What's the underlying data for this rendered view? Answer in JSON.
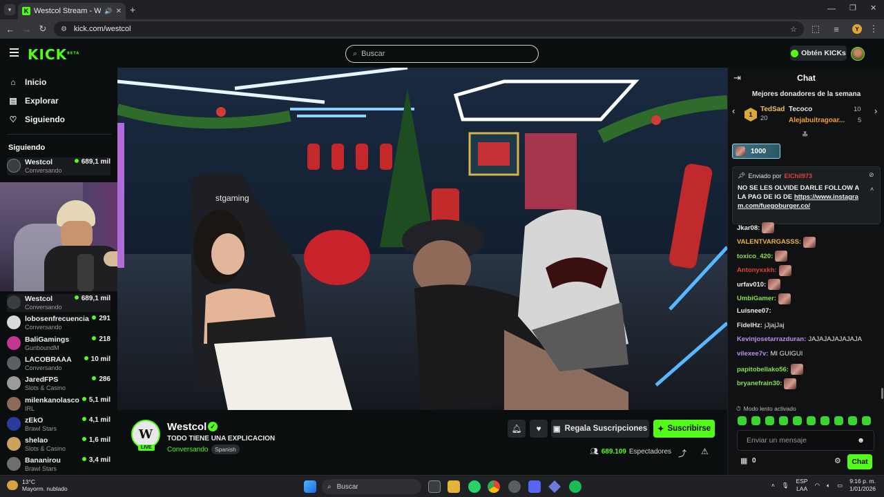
{
  "browser": {
    "tab_title": "Westcol Stream - Watch Live",
    "url": "kick.com/westcol",
    "profile_initial": "Y"
  },
  "header": {
    "logo": "KICK",
    "logo_badge": "BETA",
    "search_placeholder": "Buscar",
    "get_kicks": "Obtén KICKs"
  },
  "sidebar": {
    "nav": [
      {
        "label": "Inicio",
        "icon": "home-icon"
      },
      {
        "label": "Explorar",
        "icon": "compass-icon"
      },
      {
        "label": "Siguiendo",
        "icon": "heart-icon"
      }
    ],
    "following_heading": "Siguiendo",
    "top_channel": {
      "name": "Westcol",
      "category": "Conversando",
      "viewers": "689,1 mil"
    },
    "channels": [
      {
        "name": "Westcol",
        "category": "Conversando",
        "viewers": "689,1 mil",
        "color": "#3a3d42"
      },
      {
        "name": "lobosenfrecuencia",
        "category": "Conversando",
        "viewers": "291",
        "color": "#d9d9d9"
      },
      {
        "name": "BaliGamings",
        "category": "GunboundM",
        "viewers": "218",
        "color": "#c2378e"
      },
      {
        "name": "LACOBRAAA",
        "category": "Conversando",
        "viewers": "10 mil",
        "color": "#5b5f66"
      },
      {
        "name": "JaredFPS",
        "category": "Slots & Casino",
        "viewers": "286",
        "color": "#9b9b9b"
      },
      {
        "name": "milenkanolasco",
        "category": "IRL",
        "viewers": "5,1 mil",
        "color": "#8f6a58"
      },
      {
        "name": "zEkO",
        "category": "Brawl Stars",
        "viewers": "4,1 mil",
        "color": "#2a3b9c"
      },
      {
        "name": "shelao",
        "category": "Slots & Casino",
        "viewers": "1,6 mil",
        "color": "#c9a35f"
      },
      {
        "name": "Bananirou",
        "category": "Brawl Stars",
        "viewers": "3,4 mil",
        "color": "#6f6f6f"
      }
    ]
  },
  "stream": {
    "streamer": "Westcol",
    "avatar_text": "W",
    "live_label": "LIVE",
    "title": "TODO TIENE UNA EXPLICACION",
    "category": "Conversando",
    "language": "Spanish",
    "gift_label": "Regala Suscripciones",
    "subscribe_label": "Suscribirse",
    "viewers_count": "689.109",
    "viewers_label": "Espectadores",
    "overlay_chair_text": "stgaming"
  },
  "chat": {
    "title": "Chat",
    "top_donors_title": "Mejores donadores de la semana",
    "donors": [
      {
        "rank": "1",
        "name": "TedSad",
        "amount": "20"
      },
      {
        "name": "Tecoco",
        "amount": "10"
      },
      {
        "name": "Alejabuitragoar...",
        "amount": "5"
      }
    ],
    "kicks_bar": "1000",
    "pinned": {
      "sent_by": "Enviado por",
      "user": "ElChil973",
      "message": "NO SE LES OLVIDE DARLE FOLLOW A LA PAG DE IG DE",
      "link": "https://www.instagram.com/fuegoburger.co/"
    },
    "messages": [
      {
        "user": "Jkar08:",
        "text": "",
        "color": "#f0f0f0",
        "emote": true
      },
      {
        "user": "VALENTVARGASSS:",
        "text": "",
        "color": "#f0b43a",
        "emote": true
      },
      {
        "user": "toxico_420:",
        "text": "",
        "color": "#8be04a",
        "emote": true
      },
      {
        "user": "Antonyxxkh:",
        "text": "",
        "color": "#e0423a",
        "emote": true
      },
      {
        "user": "urfav010:",
        "text": "",
        "color": "#f0f0f0",
        "emote": true
      },
      {
        "user": "UmbiGamer:",
        "text": "",
        "color": "#8be04a",
        "emote": true
      },
      {
        "user": "Luisnee07:",
        "text": "",
        "color": "#f0f0f0",
        "emote": false
      },
      {
        "user": "FidelHz:",
        "text": "jJjajJaj",
        "color": "#e8e8e8",
        "emote": false
      },
      {
        "user": "Kevinjosetarrazduran:",
        "text": "JAJAJAJAJAJAJA",
        "color": "#c58cf0",
        "emote": false
      },
      {
        "user": "vilexee7v:",
        "text": "MI GUIGUI",
        "color": "#c58cf0",
        "emote": false
      },
      {
        "user": "papitobellako56:",
        "text": "",
        "color": "#8be04a",
        "emote": true
      },
      {
        "user": "bryanefrain30:",
        "text": "",
        "color": "#8be04a",
        "emote": true
      }
    ],
    "slow_mode": "Modo lento activado",
    "input_placeholder": "Enviar un mensaje",
    "kicks_count": "0",
    "send_label": "Chat"
  },
  "taskbar": {
    "temp": "13°C",
    "weather": "Mayorm. nublado",
    "search": "Buscar",
    "lang1": "ESP",
    "lang2": "LAA",
    "time": "9:16 p. m.",
    "date": "1/01/2026"
  }
}
